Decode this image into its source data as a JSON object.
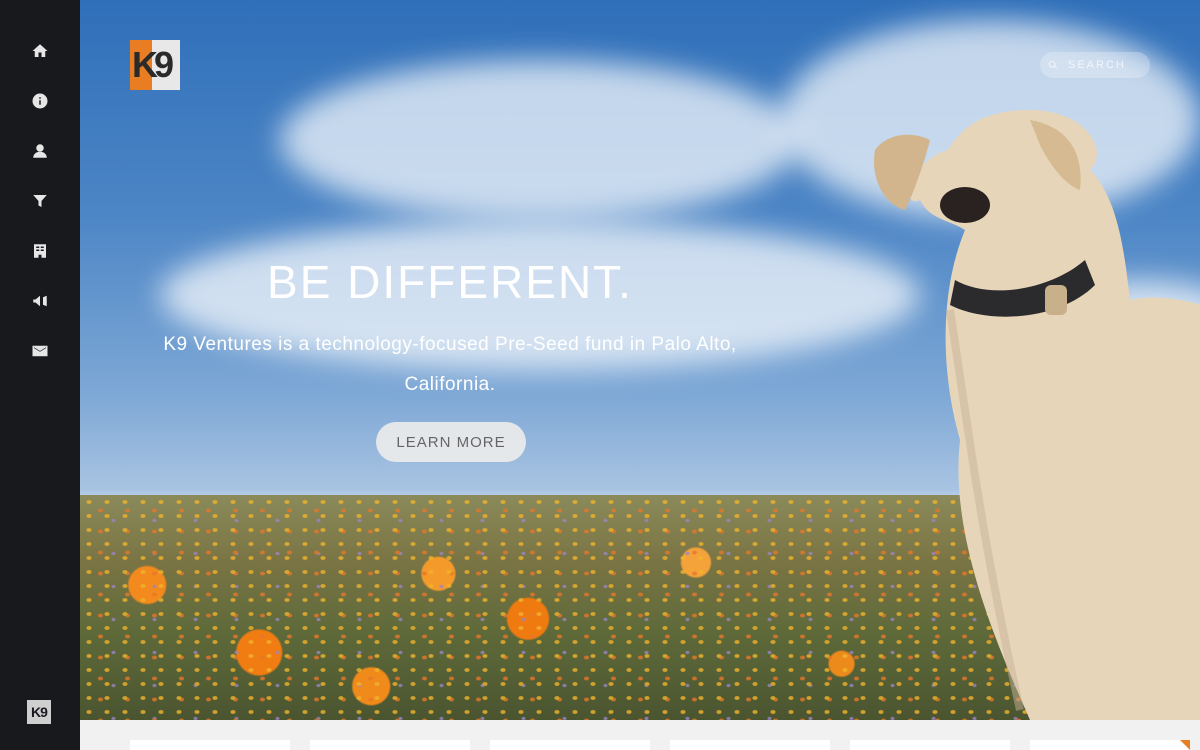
{
  "sidebar": {
    "items": [
      {
        "name": "home",
        "icon": "home-icon"
      },
      {
        "name": "about",
        "icon": "info-icon"
      },
      {
        "name": "team",
        "icon": "user-icon"
      },
      {
        "name": "funnel",
        "icon": "funnel-icon"
      },
      {
        "name": "portfolio",
        "icon": "building-icon"
      },
      {
        "name": "news",
        "icon": "megaphone-icon"
      },
      {
        "name": "contact",
        "icon": "envelope-icon"
      }
    ],
    "footer_logo": "K9"
  },
  "header": {
    "logo_text": "K9",
    "search_placeholder": "SEARCH"
  },
  "hero": {
    "headline": "BE DIFFERENT.",
    "subtitle": "K9 Ventures is a technology-focused Pre-Seed fund in Palo Alto, California.",
    "cta_label": "LEARN MORE"
  },
  "colors": {
    "accent": "#e87d24",
    "sidebar_bg": "#17191d"
  }
}
